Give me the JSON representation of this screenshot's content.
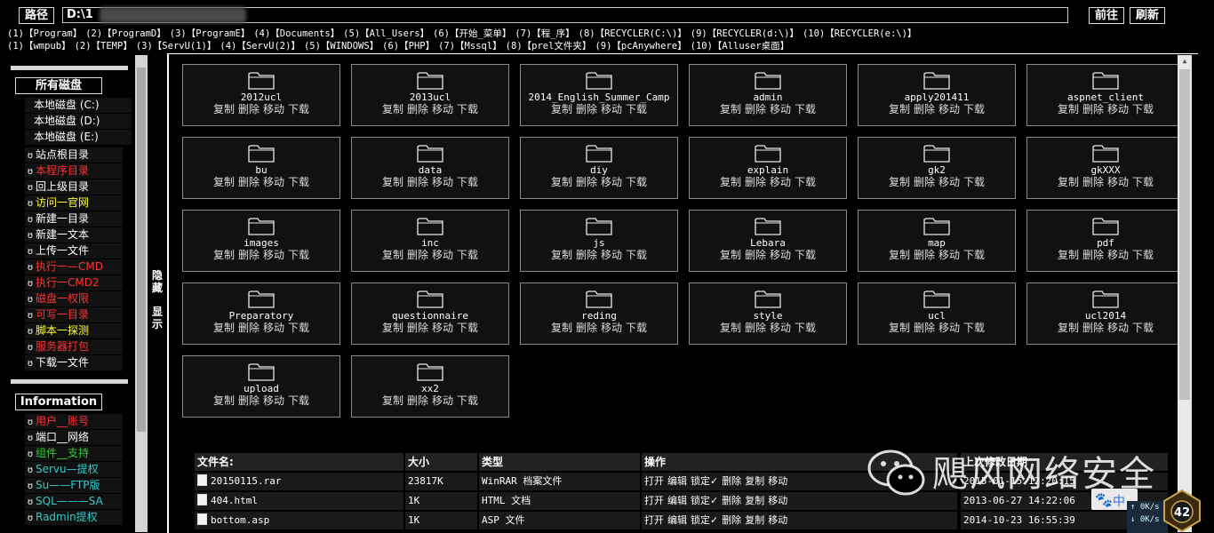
{
  "toolbar": {
    "path_button": "路径",
    "path_value": "D:\\1",
    "forward_button": "前往",
    "refresh_button": "刷新"
  },
  "quick_links_row1": [
    "(1)【Program】",
    "(2)【ProgramD】",
    "(3)【ProgramE】",
    "(4)【Documents】",
    "(5)【All_Users】",
    "(6)【开始_菜单】",
    "(7)【程_序】",
    "(8)【RECYCLER(C:\\)】",
    "(9)【RECYCLER(d:\\)】",
    "(10)【RECYCLER(e:\\)】"
  ],
  "quick_links_row2": [
    "(1)【wmpub】",
    "(2)【TEMP】",
    "(3)【ServU(1)】",
    "(4)【ServU(2)】",
    "(5)【WINDOWS】",
    "(6)【PHP】",
    "(7)【Mssql】",
    "(8)【prel文件夹】",
    "(9)【pcAnywhere】",
    "(10)【Alluser桌面】"
  ],
  "sidebar": {
    "disks_title": "所有磁盘",
    "drives": [
      "本地磁盘 (C:)",
      "本地磁盘 (D:)",
      "本地磁盘 (E:)"
    ],
    "actions": [
      {
        "label": "站点根目录",
        "color": "#ffffff"
      },
      {
        "label": "本程序目录",
        "color": "#ff3333"
      },
      {
        "label": "回上级目录",
        "color": "#ffffff"
      },
      {
        "label": "访问一官网",
        "color": "#ffff33"
      },
      {
        "label": "新建一目录",
        "color": "#ffffff"
      },
      {
        "label": "新建一文本",
        "color": "#ffffff"
      },
      {
        "label": "上传一文件",
        "color": "#ffffff"
      },
      {
        "label": "执行一—CMD",
        "color": "#ff3333"
      },
      {
        "label": "执行一CMD2",
        "color": "#ff3333"
      },
      {
        "label": "磁盘一权限",
        "color": "#ff3333"
      },
      {
        "label": "可写一目录",
        "color": "#ff3333"
      },
      {
        "label": "脚本一探测",
        "color": "#ffff33"
      },
      {
        "label": "服务器打包",
        "color": "#ff3333"
      },
      {
        "label": "下载一文件",
        "color": "#ffffff"
      }
    ],
    "info_title": "Information",
    "info_items": [
      {
        "label": "用户__账号",
        "color": "#ff3333"
      },
      {
        "label": "端口__网络",
        "color": "#ffffff"
      },
      {
        "label": "组件__支持",
        "color": "#33cc33"
      },
      {
        "label": "Servu—提权",
        "color": "#33cccc"
      },
      {
        "label": "Su——FTP版",
        "color": "#33cccc"
      },
      {
        "label": "SQL———SA",
        "color": "#33cccc"
      },
      {
        "label": "Radmin提权",
        "color": "#33cccc"
      }
    ]
  },
  "toggle": {
    "hide": "隐藏",
    "show": "显示"
  },
  "folder_ops": [
    "复制",
    "删除",
    "移动",
    "下载"
  ],
  "folders": [
    "2012ucl",
    "2013ucl",
    "2014_English_Summer_Camp",
    "admin",
    "apply201411",
    "aspnet_client",
    "bu",
    "data",
    "diy",
    "explain",
    "gk2",
    "gkXXX",
    "images",
    "inc",
    "js",
    "Lebara",
    "map",
    "pdf",
    "Preparatory",
    "questionnaire",
    "reding",
    "style",
    "ucl",
    "ucl2014",
    "upload",
    "xx2"
  ],
  "file_table": {
    "headers": {
      "name": "文件名:",
      "size": "大小",
      "type": "类型",
      "ops": "操作",
      "modified": "上次修改日期"
    },
    "file_ops": [
      "打开",
      "编辑",
      "锁定✓",
      "删除",
      "复制",
      "移动"
    ],
    "rows": [
      {
        "name": "20150115.rar",
        "size": "23817K",
        "type": "WinRAR 档案文件",
        "modified": "2015-01-15 12:20:15"
      },
      {
        "name": "404.html",
        "size": "1K",
        "type": "HTML 文档",
        "modified": "2013-06-27 14:22:06"
      },
      {
        "name": "bottom.asp",
        "size": "1K",
        "type": "ASP 文件",
        "modified": "2014-10-23 16:55:39"
      }
    ]
  },
  "watermark": {
    "text": "飓风网络安全"
  },
  "widget": {
    "chinese": "中",
    "up_speed": "0K/s",
    "down_speed": "0K/s",
    "badge": "42"
  },
  "colors": {
    "bg": "#000000",
    "panel": "#111111",
    "border": "#8a8a8a",
    "red": "#ff3333",
    "yellow": "#ffff33",
    "cyan": "#33cccc",
    "green": "#33cc33"
  }
}
